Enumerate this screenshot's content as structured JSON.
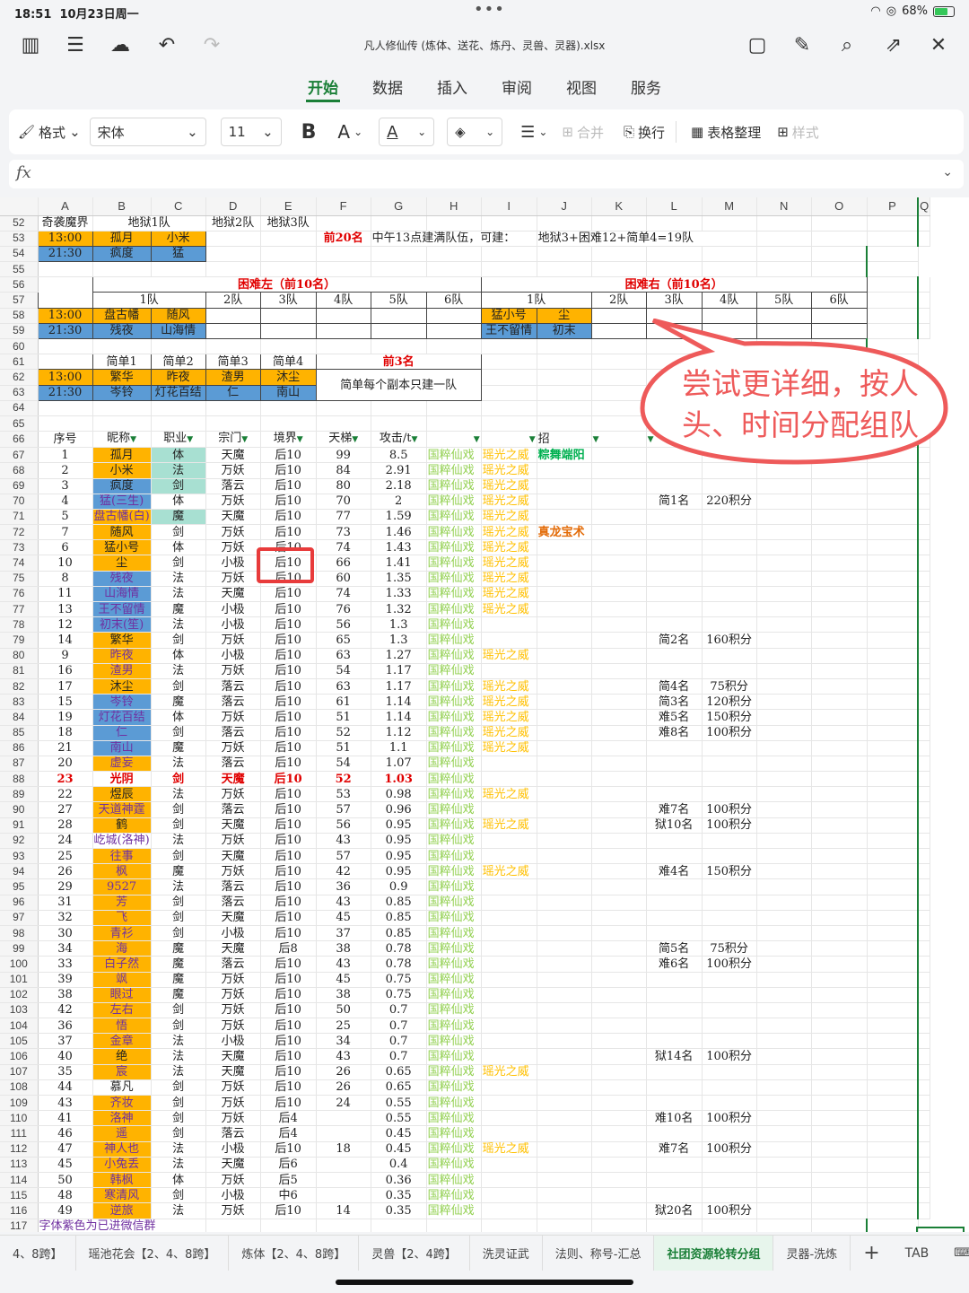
{
  "status": {
    "time": "18:51",
    "date": "10月23日周一",
    "battery": "68%"
  },
  "file": {
    "name": "凡人修仙传 (炼体、送花、炼丹、灵兽、灵器).xlsx"
  },
  "menu": {
    "tabs": [
      "开始",
      "数据",
      "插入",
      "审阅",
      "视图",
      "服务"
    ],
    "active": "开始"
  },
  "toolbar": {
    "format": "格式",
    "font": "宋体",
    "size": "11",
    "merge": "合并",
    "wrap": "换行",
    "tidy": "表格整理",
    "style": "样式"
  },
  "callout": {
    "text": "尝试更详细，按人头、时间分配组队"
  },
  "sheet": {
    "columns": [
      "A",
      "B",
      "C",
      "D",
      "E",
      "F",
      "G",
      "H",
      "I",
      "J",
      "K",
      "L",
      "M",
      "N",
      "O",
      "P",
      "Q"
    ],
    "top": {
      "r52": [
        "52",
        "奇袭魔界",
        "地狱1队",
        "地狱2队",
        "地狱3队"
      ],
      "r53": [
        "53",
        "13:00",
        "孤月",
        "小米",
        "前20名",
        "中午13点建满队伍，可建：",
        "地狱3+困难12+简单4=19队"
      ],
      "r54": [
        "54",
        "21:30",
        "疯度",
        "猛"
      ],
      "r55": [
        "55"
      ],
      "r56": [
        "56",
        "困难左（前10名）",
        "困难右（前10名）"
      ],
      "r57": [
        "57",
        "1队",
        "2队",
        "3队",
        "4队",
        "5队",
        "6队",
        "1队",
        "2队",
        "3队",
        "4队",
        "5队",
        "6队"
      ],
      "r58": [
        "58",
        "13:00",
        "盘古幡",
        "随风",
        "猛小号",
        "尘"
      ],
      "r59": [
        "59",
        "21:30",
        "残夜",
        "山海情",
        "王不留情",
        "初末"
      ],
      "r60": [
        "60"
      ],
      "r61": [
        "61",
        "简单1",
        "简单2",
        "简单3",
        "简单4",
        "前3名"
      ],
      "r62": [
        "62",
        "13:00",
        "繁华",
        "昨夜",
        "渣男",
        "沐尘",
        "简单每个副本只建一队"
      ],
      "r63": [
        "63",
        "21:30",
        "岑铃",
        "灯花百结",
        "仁",
        "南山"
      ],
      "r64": [
        "64"
      ],
      "r65": [
        "65"
      ],
      "r66": [
        "66",
        "序号",
        "昵称",
        "职业",
        "宗门",
        "境界",
        "天梯",
        "攻击/t",
        "招"
      ]
    },
    "rows": [
      [
        "67",
        "1",
        "孤月",
        "体",
        "天魔",
        "后10",
        "99",
        "8.5",
        "国粹仙戏",
        "瑶光之威",
        "粽舞端阳",
        "",
        ""
      ],
      [
        "68",
        "2",
        "小米",
        "法",
        "万妖",
        "后10",
        "84",
        "2.91",
        "国粹仙戏",
        "瑶光之威",
        "",
        "",
        ""
      ],
      [
        "69",
        "3",
        "疯度",
        "剑",
        "落云",
        "后10",
        "80",
        "2.18",
        "国粹仙戏",
        "瑶光之威",
        "",
        "",
        ""
      ],
      [
        "70",
        "4",
        "猛(三生)",
        "体",
        "万妖",
        "后10",
        "70",
        "2",
        "国粹仙戏",
        "瑶光之威",
        "",
        "简1名",
        "220积分"
      ],
      [
        "71",
        "5",
        "盘古幡(白)",
        "魔",
        "天魔",
        "后10",
        "77",
        "1.59",
        "国粹仙戏",
        "瑶光之威",
        "",
        "",
        ""
      ],
      [
        "72",
        "7",
        "随风",
        "剑",
        "万妖",
        "后10",
        "73",
        "1.46",
        "国粹仙戏",
        "瑶光之威",
        "真龙宝术",
        "",
        ""
      ],
      [
        "73",
        "6",
        "猛小号",
        "体",
        "万妖",
        "后10",
        "74",
        "1.43",
        "国粹仙戏",
        "瑶光之威",
        "",
        "",
        ""
      ],
      [
        "74",
        "10",
        "尘",
        "剑",
        "小极",
        "后10",
        "66",
        "1.41",
        "国粹仙戏",
        "瑶光之威",
        "",
        "",
        ""
      ],
      [
        "75",
        "8",
        "残夜",
        "法",
        "万妖",
        "后10",
        "60",
        "1.35",
        "国粹仙戏",
        "瑶光之威",
        "",
        "",
        ""
      ],
      [
        "76",
        "11",
        "山海情",
        "法",
        "天魔",
        "后10",
        "74",
        "1.33",
        "国粹仙戏",
        "瑶光之威",
        "",
        "",
        ""
      ],
      [
        "77",
        "13",
        "王不留情",
        "魔",
        "小极",
        "后10",
        "76",
        "1.32",
        "国粹仙戏",
        "瑶光之威",
        "",
        "",
        ""
      ],
      [
        "78",
        "12",
        "初末(笙)",
        "法",
        "小极",
        "后10",
        "56",
        "1.3",
        "国粹仙戏",
        "",
        "",
        "",
        ""
      ],
      [
        "79",
        "14",
        "繁华",
        "剑",
        "万妖",
        "后10",
        "65",
        "1.3",
        "国粹仙戏",
        "",
        "",
        "简2名",
        "160积分"
      ],
      [
        "80",
        "9",
        "昨夜",
        "体",
        "小极",
        "后10",
        "63",
        "1.27",
        "国粹仙戏",
        "瑶光之威",
        "",
        "",
        ""
      ],
      [
        "81",
        "16",
        "渣男",
        "法",
        "万妖",
        "后10",
        "54",
        "1.17",
        "国粹仙戏",
        "",
        "",
        "",
        ""
      ],
      [
        "82",
        "17",
        "沐尘",
        "剑",
        "落云",
        "后10",
        "63",
        "1.17",
        "国粹仙戏",
        "瑶光之威",
        "",
        "简4名",
        "75积分"
      ],
      [
        "83",
        "15",
        "岑铃",
        "魔",
        "落云",
        "后10",
        "61",
        "1.14",
        "国粹仙戏",
        "瑶光之威",
        "",
        "简3名",
        "120积分"
      ],
      [
        "84",
        "19",
        "灯花百结",
        "体",
        "万妖",
        "后10",
        "51",
        "1.14",
        "国粹仙戏",
        "瑶光之威",
        "",
        "难5名",
        "150积分"
      ],
      [
        "85",
        "18",
        "仁",
        "剑",
        "落云",
        "后10",
        "52",
        "1.12",
        "国粹仙戏",
        "瑶光之威",
        "",
        "难8名",
        "100积分"
      ],
      [
        "86",
        "21",
        "南山",
        "魔",
        "万妖",
        "后10",
        "51",
        "1.1",
        "国粹仙戏",
        "瑶光之威",
        "",
        "",
        ""
      ],
      [
        "87",
        "20",
        "虚妄",
        "法",
        "落云",
        "后10",
        "54",
        "1.07",
        "国粹仙戏",
        "",
        "",
        "",
        ""
      ],
      [
        "88",
        "23",
        "光阴",
        "剑",
        "天魔",
        "后10",
        "52",
        "1.03",
        "国粹仙戏",
        "",
        "",
        "",
        ""
      ],
      [
        "89",
        "22",
        "煜辰",
        "法",
        "万妖",
        "后10",
        "53",
        "0.98",
        "国粹仙戏",
        "瑶光之威",
        "",
        "",
        ""
      ],
      [
        "90",
        "27",
        "天道神霆",
        "剑",
        "落云",
        "后10",
        "57",
        "0.96",
        "国粹仙戏",
        "",
        "",
        "难7名",
        "100积分"
      ],
      [
        "91",
        "28",
        "鹤",
        "剑",
        "天魔",
        "后10",
        "56",
        "0.95",
        "国粹仙戏",
        "瑶光之威",
        "",
        "狱10名",
        "100积分"
      ],
      [
        "92",
        "24",
        "屹城(洛神)",
        "法",
        "万妖",
        "后10",
        "43",
        "0.95",
        "国粹仙戏",
        "",
        "",
        "",
        ""
      ],
      [
        "93",
        "25",
        "往事",
        "剑",
        "天魔",
        "后10",
        "57",
        "0.95",
        "国粹仙戏",
        "",
        "",
        "",
        ""
      ],
      [
        "94",
        "26",
        "枫",
        "魔",
        "万妖",
        "后10",
        "42",
        "0.95",
        "国粹仙戏",
        "瑶光之威",
        "",
        "难4名",
        "150积分"
      ],
      [
        "95",
        "29",
        "9527",
        "法",
        "落云",
        "后10",
        "36",
        "0.9",
        "国粹仙戏",
        "",
        "",
        "",
        ""
      ],
      [
        "96",
        "31",
        "芳",
        "剑",
        "落云",
        "后10",
        "43",
        "0.85",
        "国粹仙戏",
        "",
        "",
        "",
        ""
      ],
      [
        "97",
        "32",
        "飞",
        "剑",
        "天魔",
        "后10",
        "45",
        "0.85",
        "国粹仙戏",
        "",
        "",
        "",
        ""
      ],
      [
        "98",
        "30",
        "青衫",
        "剑",
        "小极",
        "后10",
        "37",
        "0.85",
        "国粹仙戏",
        "",
        "",
        "",
        ""
      ],
      [
        "99",
        "34",
        "海",
        "魔",
        "天魔",
        "后8",
        "38",
        "0.78",
        "国粹仙戏",
        "",
        "",
        "简5名",
        "75积分"
      ],
      [
        "100",
        "33",
        "白子然",
        "魔",
        "落云",
        "后10",
        "43",
        "0.78",
        "国粹仙戏",
        "",
        "",
        "难6名",
        "100积分"
      ],
      [
        "101",
        "39",
        "飒",
        "魔",
        "万妖",
        "后10",
        "45",
        "0.75",
        "国粹仙戏",
        "",
        "",
        "",
        ""
      ],
      [
        "102",
        "38",
        "眼过",
        "魔",
        "万妖",
        "后10",
        "38",
        "0.75",
        "国粹仙戏",
        "",
        "",
        "",
        ""
      ],
      [
        "103",
        "42",
        "左右",
        "剑",
        "万妖",
        "后10",
        "50",
        "0.7",
        "国粹仙戏",
        "",
        "",
        "",
        ""
      ],
      [
        "104",
        "36",
        "悟",
        "剑",
        "万妖",
        "后10",
        "25",
        "0.7",
        "国粹仙戏",
        "",
        "",
        "",
        ""
      ],
      [
        "105",
        "37",
        "金章",
        "法",
        "小极",
        "后10",
        "34",
        "0.7",
        "国粹仙戏",
        "",
        "",
        "",
        ""
      ],
      [
        "106",
        "40",
        "绝",
        "法",
        "天魔",
        "后10",
        "43",
        "0.7",
        "国粹仙戏",
        "",
        "",
        "狱14名",
        "100积分"
      ],
      [
        "107",
        "35",
        "宸",
        "法",
        "天魔",
        "后10",
        "26",
        "0.65",
        "国粹仙戏",
        "瑶光之威",
        "",
        "",
        ""
      ],
      [
        "108",
        "44",
        "慕凡",
        "剑",
        "万妖",
        "后10",
        "26",
        "0.65",
        "国粹仙戏",
        "",
        "",
        "",
        ""
      ],
      [
        "109",
        "43",
        "齐妆",
        "剑",
        "万妖",
        "后10",
        "24",
        "0.55",
        "国粹仙戏",
        "",
        "",
        "",
        ""
      ],
      [
        "110",
        "41",
        "洛神",
        "剑",
        "万妖",
        "后4",
        "",
        "0.55",
        "国粹仙戏",
        "",
        "",
        "难10名",
        "100积分"
      ],
      [
        "111",
        "46",
        "遥",
        "剑",
        "落云",
        "后4",
        "",
        "0.45",
        "国粹仙戏",
        "",
        "",
        "",
        ""
      ],
      [
        "112",
        "47",
        "神人也",
        "法",
        "小极",
        "后10",
        "18",
        "0.45",
        "国粹仙戏",
        "瑶光之威",
        "",
        "难7名",
        "100积分"
      ],
      [
        "113",
        "45",
        "小兔丢",
        "法",
        "天魔",
        "后6",
        "",
        "0.4",
        "国粹仙戏",
        "",
        "",
        "",
        ""
      ],
      [
        "114",
        "50",
        "韩枫",
        "体",
        "万妖",
        "后5",
        "",
        "0.36",
        "国粹仙戏",
        "",
        "",
        "",
        ""
      ],
      [
        "115",
        "48",
        "寒清风",
        "剑",
        "小极",
        "中6",
        "",
        "0.35",
        "国粹仙戏",
        "",
        "",
        "",
        ""
      ],
      [
        "116",
        "49",
        "逆旅",
        "法",
        "万妖",
        "后10",
        "14",
        "0.35",
        "国粹仙戏",
        "",
        "",
        "狱20名",
        "100积分"
      ]
    ],
    "r117": [
      "117",
      "字体紫色为已进微信群"
    ]
  },
  "sheettabs": [
    "4、8跨】",
    "瑶池花会【2、4、8跨】",
    "炼体【2、4、8跨】",
    "灵兽【2、4跨】",
    "洗灵证武",
    "法则、称号-汇总",
    "社团资源轮转分组",
    "灵器-洗炼",
    "+",
    "TAB"
  ],
  "sheettabs_active": "社团资源轮转分组",
  "colors": {
    "accent": "#1a7f37",
    "orange": "#ffb300",
    "blue": "#5b9bd5",
    "teal": "#a8e0d2",
    "callout": "#ee5a5a"
  }
}
